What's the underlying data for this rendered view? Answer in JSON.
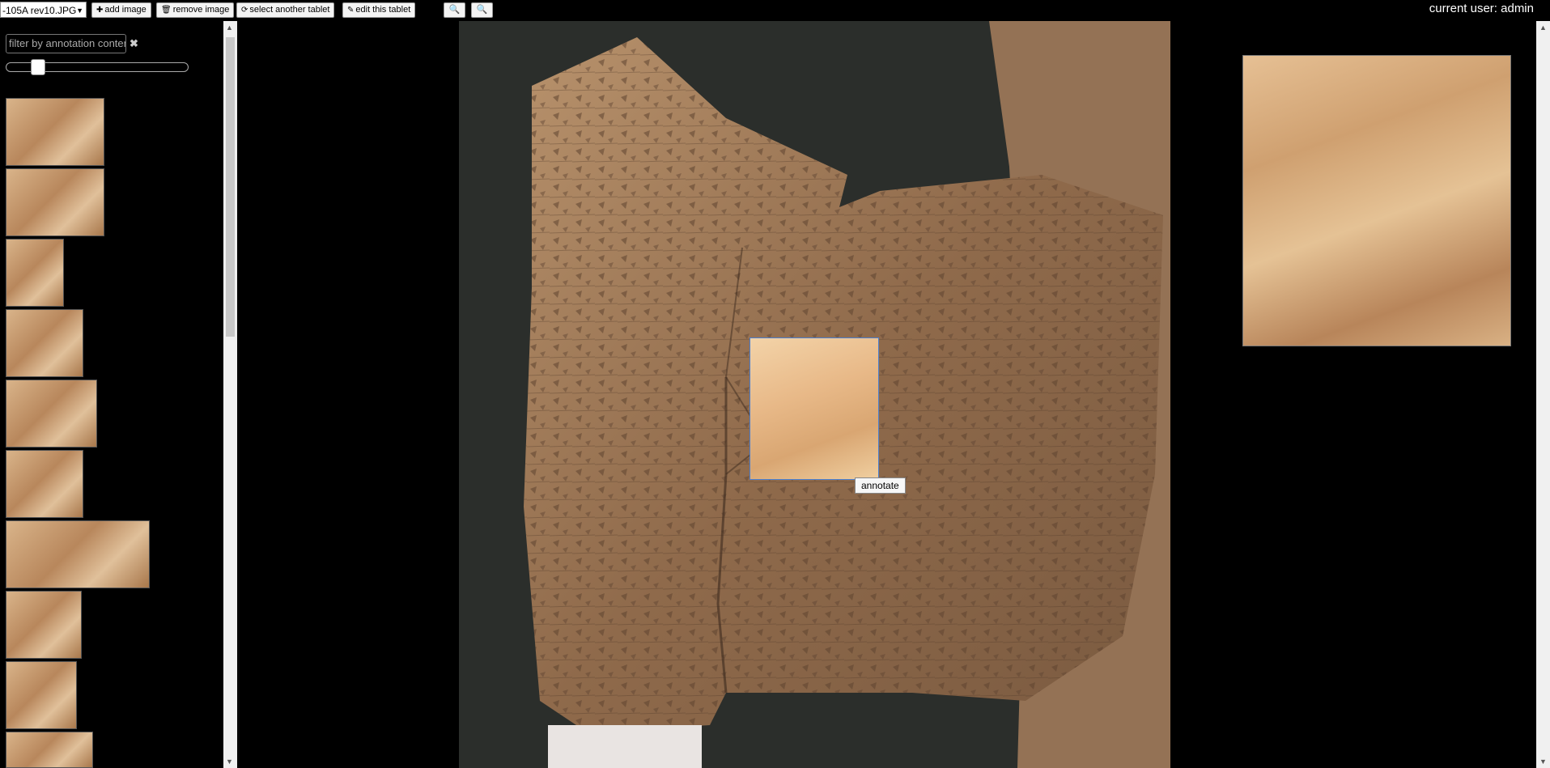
{
  "toolbar": {
    "image_select": "-105A rev10.JPG",
    "add_image": "add image",
    "remove_image": "remove image",
    "select_tablet": "select another tablet",
    "edit_tablet": "edit this tablet",
    "user_label": "current user: admin"
  },
  "sidebar": {
    "filter_placeholder": "filter by annotation content",
    "clear_symbol": "✖",
    "thumbnail_count": 10
  },
  "viewer": {
    "annotate_label": "annotate"
  },
  "colors": {
    "background": "#000000",
    "selection_border": "#4a7fd0"
  }
}
